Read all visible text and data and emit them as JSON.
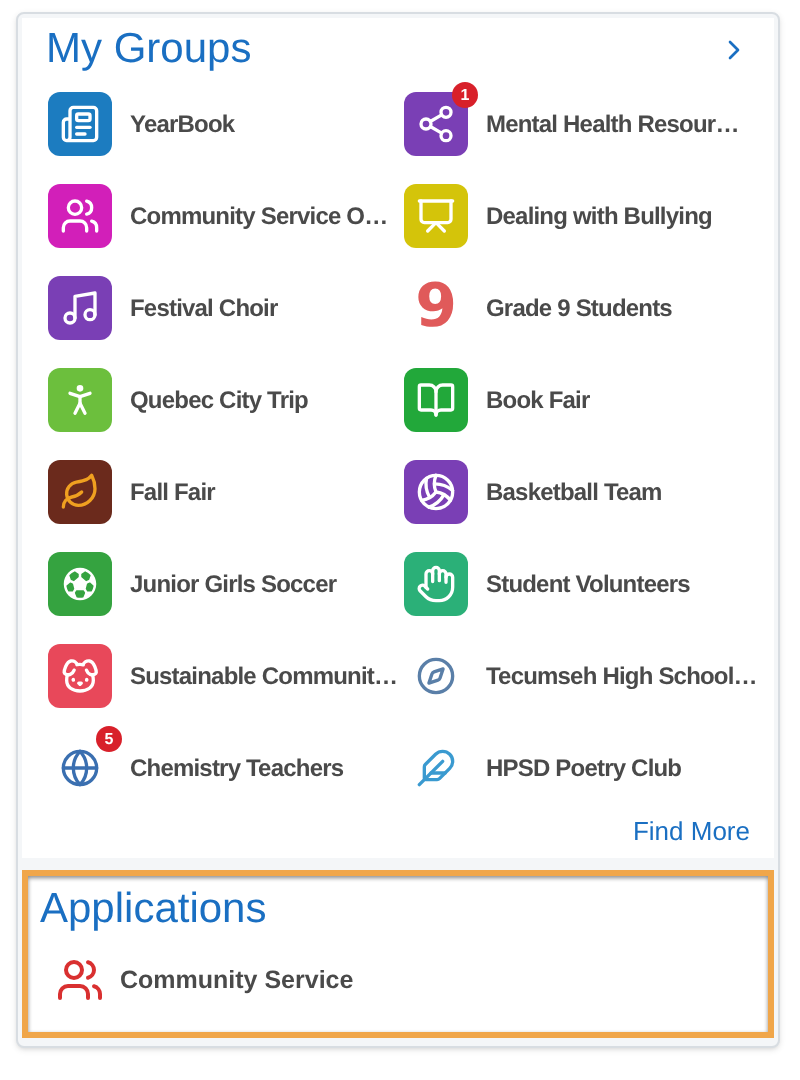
{
  "groups": {
    "title": "My Groups",
    "items": [
      {
        "name": "YearBook"
      },
      {
        "name": "Mental Health Resour…",
        "badge": "1"
      },
      {
        "name": "Community Service O…"
      },
      {
        "name": "Dealing with Bullying"
      },
      {
        "name": "Festival Choir"
      },
      {
        "name": "Grade 9 Students",
        "icon_glyph": "9"
      },
      {
        "name": "Quebec City Trip"
      },
      {
        "name": "Book Fair"
      },
      {
        "name": "Fall Fair"
      },
      {
        "name": "Basketball Team"
      },
      {
        "name": "Junior Girls Soccer"
      },
      {
        "name": "Student Volunteers"
      },
      {
        "name": "Sustainable Communit…"
      },
      {
        "name": "Tecumseh High School…"
      },
      {
        "name": "Chemistry Teachers",
        "badge": "5"
      },
      {
        "name": "HPSD Poetry Club"
      }
    ],
    "find_more": "Find More"
  },
  "applications": {
    "title": "Applications",
    "items": [
      {
        "name": "Community Service"
      }
    ]
  }
}
